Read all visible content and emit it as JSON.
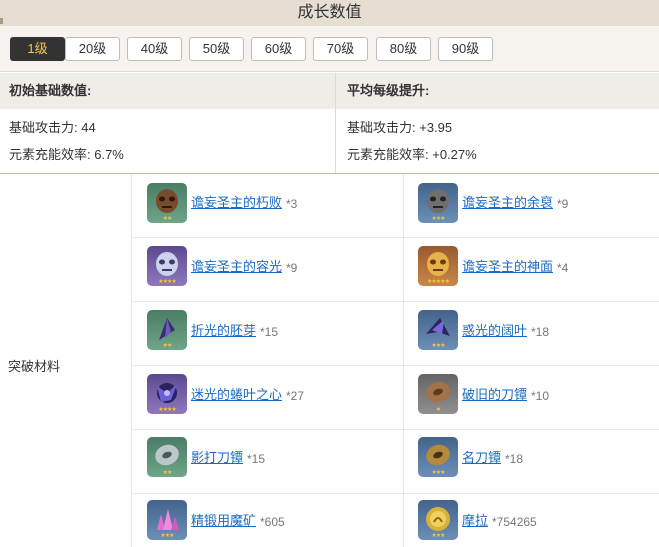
{
  "header": {
    "title": "成长数值"
  },
  "levels": [
    {
      "label": "1级",
      "active": true
    },
    {
      "label": "20级",
      "active": false
    },
    {
      "label": "40级",
      "active": false
    },
    {
      "label": "50级",
      "active": false
    },
    {
      "label": "60级",
      "active": false
    },
    {
      "label": "70级",
      "active": false
    },
    {
      "label": "80级",
      "active": false
    },
    {
      "label": "90级",
      "active": false
    }
  ],
  "stats": {
    "base": {
      "heading": "初始基础数值:",
      "lines": [
        "基础攻击力: 44",
        "元素充能效率: 6.7%"
      ]
    },
    "growth": {
      "heading": "平均每级提升:",
      "lines": [
        "基础攻击力: +3.95",
        "元素充能效率: +0.27%"
      ]
    }
  },
  "materials": {
    "label": "突破材料",
    "items": [
      {
        "name": "谵妄圣主的朽败",
        "count": "*3",
        "icon": "mask-icon",
        "stars": "★★"
      },
      {
        "name": "谵妄圣主的余裒",
        "count": "*9",
        "icon": "mask-icon",
        "stars": "★★★"
      },
      {
        "name": "谵妄圣主的容光",
        "count": "*9",
        "icon": "mask-icon",
        "stars": "★★★★"
      },
      {
        "name": "谵妄圣主的神面",
        "count": "*4",
        "icon": "mask-icon",
        "stars": "★★★★★"
      },
      {
        "name": "折光的胚芽",
        "count": "*15",
        "icon": "crystal-leaf-icon",
        "stars": "★★"
      },
      {
        "name": "惑光的阔叶",
        "count": "*18",
        "icon": "crystal-leaf-icon",
        "stars": "★★★"
      },
      {
        "name": "迷光的蜷叶之心",
        "count": "*27",
        "icon": "crystal-leaf-icon",
        "stars": "★★★★"
      },
      {
        "name": "破旧的刀镡",
        "count": "*10",
        "icon": "sword-guard-icon",
        "stars": "★"
      },
      {
        "name": "影打刀镡",
        "count": "*15",
        "icon": "sword-guard-icon",
        "stars": "★★"
      },
      {
        "name": "名刀镡",
        "count": "*18",
        "icon": "sword-guard-icon",
        "stars": "★★★"
      },
      {
        "name": "精锻用魔矿",
        "count": "*605",
        "icon": "ore-icon",
        "stars": "★★★"
      },
      {
        "name": "摩拉",
        "count": "*754265",
        "icon": "mora-coin-icon",
        "stars": "★★★"
      }
    ]
  }
}
